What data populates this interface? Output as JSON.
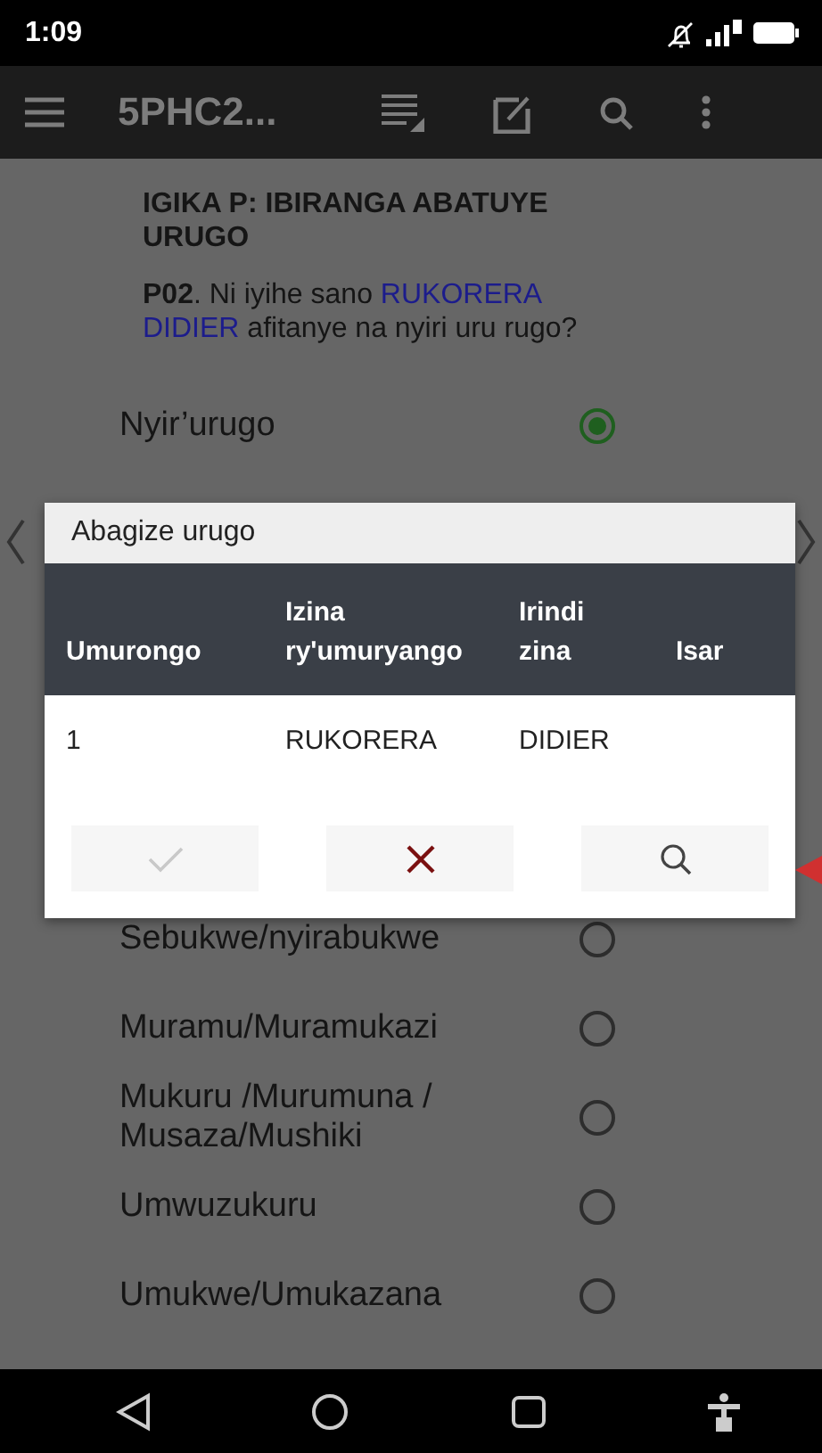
{
  "status_bar": {
    "time": "1:09"
  },
  "toolbar": {
    "title": "5PHC2..."
  },
  "section_title": "IGIKA P: IBIRANGA ABATUYE URUGO",
  "question": {
    "code": "P02",
    "before": ". Ni iyihe sano ",
    "name": "RUKORERA DIDIER",
    "after": " afitanye na nyiri uru rugo?"
  },
  "options_top": [
    {
      "label": "Nyir’urugo",
      "selected": true
    }
  ],
  "options_bottom": [
    {
      "label": "Sebukwe/nyirabukwe",
      "selected": false
    },
    {
      "label": "Muramu/Muramukazi",
      "selected": false
    },
    {
      "label": "Mukuru /Murumuna / Musaza/Mushiki",
      "selected": false
    },
    {
      "label": "Umwuzukuru",
      "selected": false
    },
    {
      "label": "Umukwe/Umukazana",
      "selected": false
    }
  ],
  "dialog": {
    "title": "Abagize urugo",
    "columns": [
      "Umurongo",
      "Izina ry'umuryango",
      "Irindi zina",
      "Isar"
    ],
    "rows": [
      [
        "1",
        "RUKORERA",
        "DIDIER"
      ]
    ],
    "buttons": [
      {
        "kind": "confirm",
        "disabled": true
      },
      {
        "kind": "cancel",
        "disabled": false
      },
      {
        "kind": "search",
        "disabled": false
      }
    ]
  }
}
